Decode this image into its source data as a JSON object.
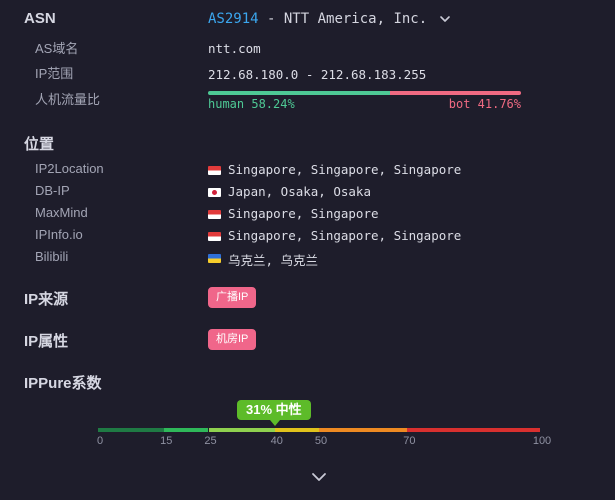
{
  "asn": {
    "section_label": "ASN",
    "number": "AS2914",
    "separator": " - ",
    "name": "NTT America, Inc."
  },
  "domain": {
    "label": "AS域名",
    "value": "ntt.com"
  },
  "ip_range": {
    "label": "IP范围",
    "value": "212.68.180.0 - 212.68.183.255"
  },
  "traffic": {
    "label": "人机流量比",
    "human_text": "human 58.24%",
    "bot_text": "bot 41.76%",
    "human_percent": 58.24,
    "bot_percent": 41.76,
    "colors": {
      "human": "#4ec995",
      "bot": "#f06a82"
    }
  },
  "location": {
    "section_label": "位置",
    "rows": [
      {
        "source": "IP2Location",
        "flag": "flag-singapore-icon",
        "value": "Singapore, Singapore, Singapore"
      },
      {
        "source": "DB-IP",
        "flag": "flag-japan-icon",
        "value": "Japan, Osaka, Osaka"
      },
      {
        "source": "MaxMind",
        "flag": "flag-singapore-icon",
        "value": "Singapore, Singapore"
      },
      {
        "source": "IPInfo.io",
        "flag": "flag-singapore-icon",
        "value": "Singapore, Singapore, Singapore"
      },
      {
        "source": "Bilibili",
        "flag": "flag-ukraine-icon",
        "value": "乌克兰, 乌克兰"
      }
    ]
  },
  "ip_source": {
    "section_label": "IP来源",
    "tag": "广播IP"
  },
  "ip_property": {
    "section_label": "IP属性",
    "tag": "机房IP"
  },
  "ippure": {
    "section_label": "IPPure系数",
    "score_label": "31% 中性",
    "score": 31,
    "ticks": [
      "0",
      "15",
      "25",
      "40",
      "50",
      "70",
      "100"
    ],
    "segments": [
      {
        "from": 0,
        "to": 15,
        "color": "#1f7a44"
      },
      {
        "from": 15,
        "to": 25,
        "color": "#2fb85a"
      },
      {
        "from": 25,
        "to": 40,
        "color": "#8fd14f"
      },
      {
        "from": 40,
        "to": 50,
        "color": "#e0c21c"
      },
      {
        "from": 50,
        "to": 70,
        "color": "#ee8a22"
      },
      {
        "from": 70,
        "to": 100,
        "color": "#d9302f"
      }
    ]
  },
  "icons": {
    "asn_dropdown": "chevron-down-icon",
    "expand_more": "chevron-down-icon"
  },
  "colors": {
    "background": "#1e1d2b",
    "link": "#3ba6ee",
    "tag": "#f0668a",
    "score_badge": "#5dbb29"
  }
}
